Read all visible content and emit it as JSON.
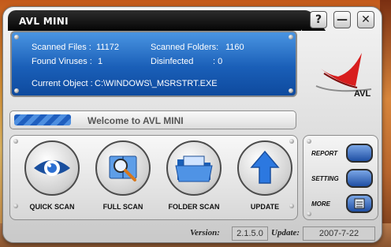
{
  "window": {
    "title": "AVL MINI"
  },
  "title_buttons": {
    "help": "?",
    "minimize": "—",
    "close": "✕"
  },
  "status": {
    "scanned_files_label": "Scanned Files :",
    "scanned_files_value": "11172",
    "scanned_folders_label": "Scanned Folders:",
    "scanned_folders_value": "1160",
    "found_viruses_label": "Found Viruses :",
    "found_viruses_value": "1",
    "disinfected_label": "Disinfected",
    "disinfected_value": ": 0",
    "current_object_label": "Current Object :",
    "current_object_value": "C:\\WINDOWS\\_MSRSTRT.EXE"
  },
  "logo": {
    "text": "AVL"
  },
  "welcome": {
    "text": "Welcome to AVL MINI"
  },
  "scan_buttons": [
    {
      "label": "QUICK SCAN",
      "icon": "eye-icon"
    },
    {
      "label": "FULL SCAN",
      "icon": "magnifier-book-icon"
    },
    {
      "label": "FOLDER SCAN",
      "icon": "folder-icon"
    },
    {
      "label": "UPDATE",
      "icon": "arrow-up-icon"
    }
  ],
  "side": {
    "report_label": "REPORT",
    "setting_label": "SETTING",
    "more_label": "MORE"
  },
  "version": {
    "version_label": "Version:",
    "version_value": "2.1.5.0",
    "update_label": "Update:",
    "update_value": "2007-7-22"
  },
  "colors": {
    "accent_blue": "#1a5fb8",
    "logo_red": "#d81e1e",
    "title_black": "#050505"
  }
}
